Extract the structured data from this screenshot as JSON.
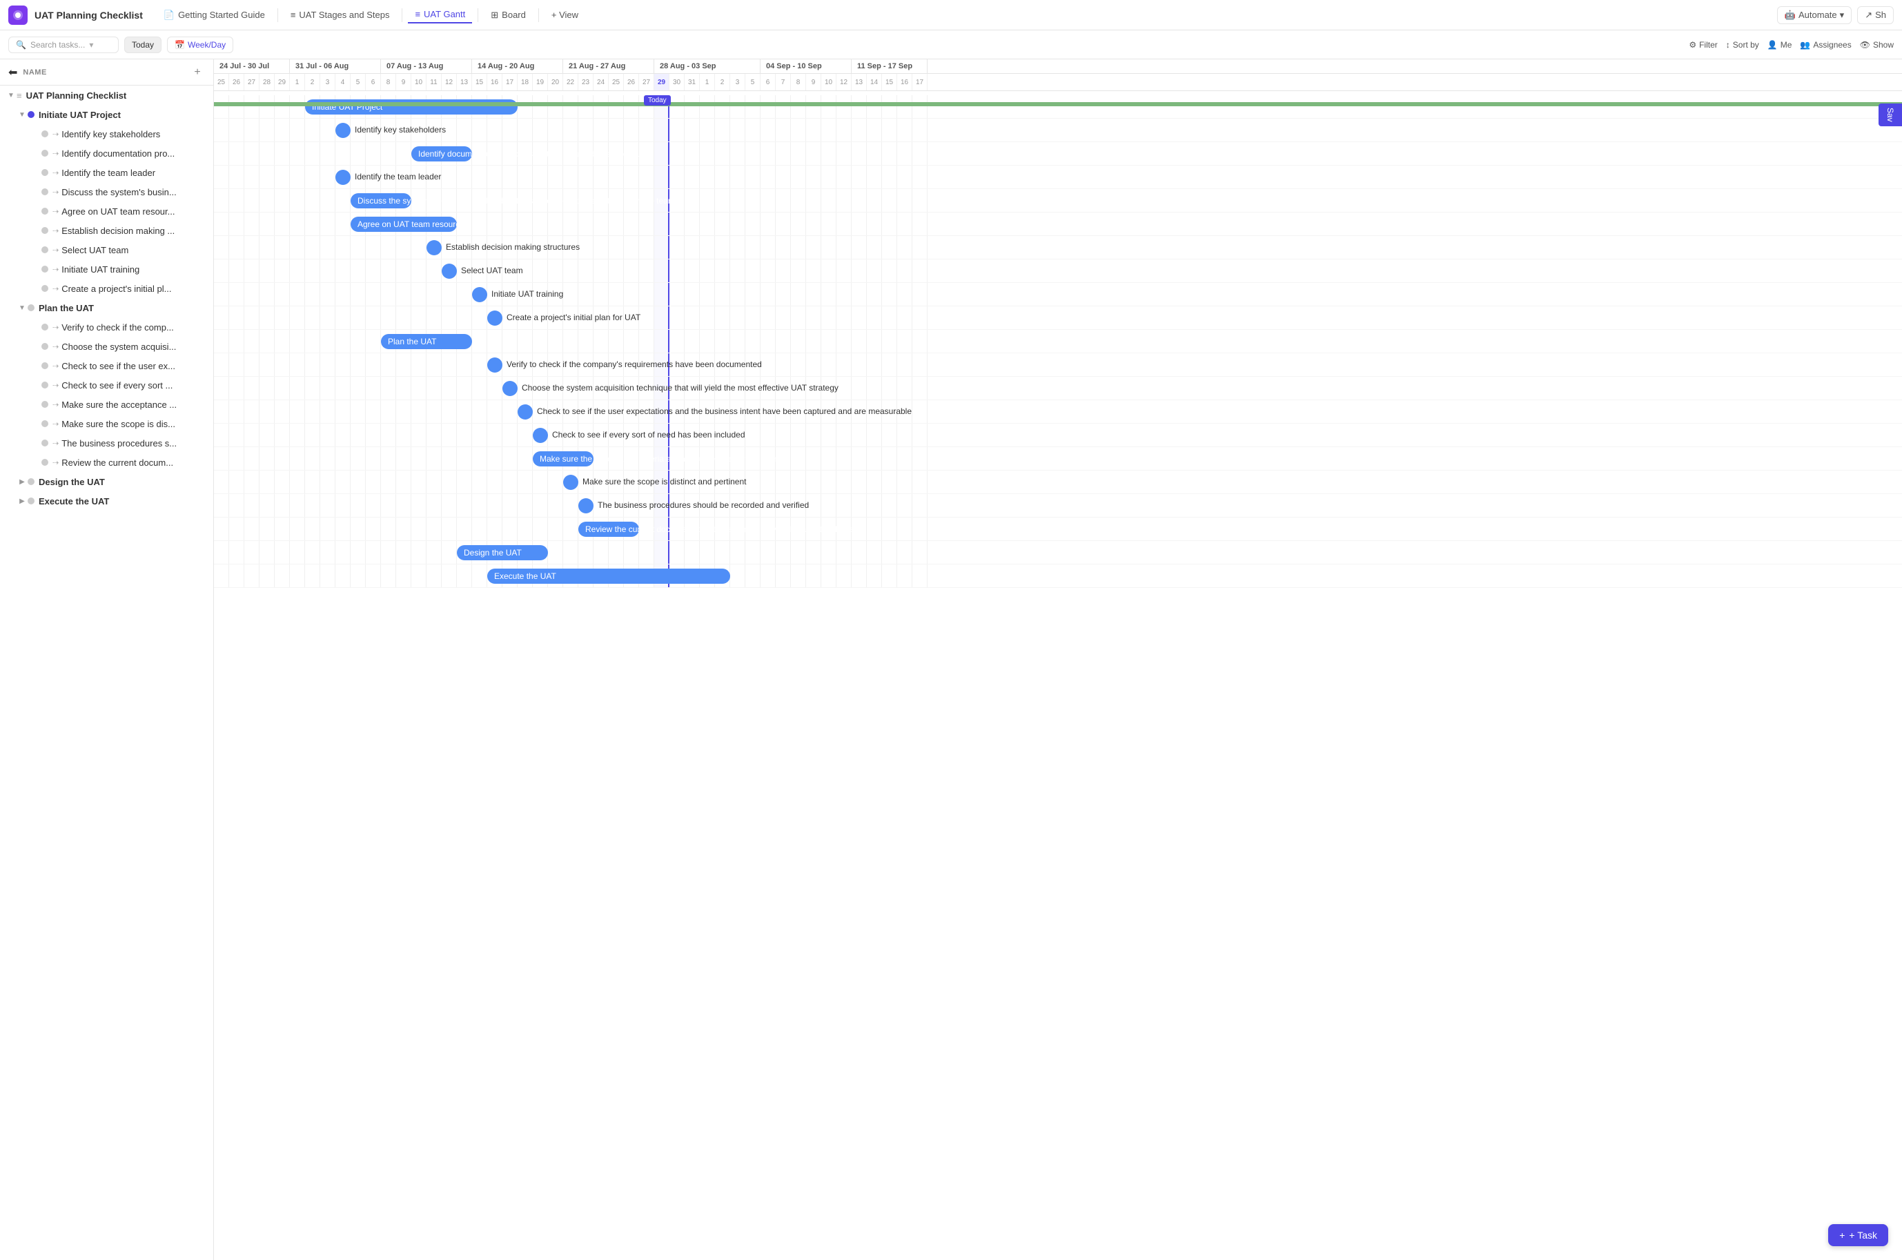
{
  "app": {
    "icon": "◉",
    "title": "UAT Planning Checklist"
  },
  "nav": {
    "tabs": [
      {
        "id": "getting-started",
        "label": "Getting Started Guide",
        "icon": "📄",
        "active": false
      },
      {
        "id": "stages-steps",
        "label": "UAT Stages and Steps",
        "icon": "≡",
        "active": false
      },
      {
        "id": "gantt",
        "label": "UAT Gantt",
        "icon": "≡",
        "active": true
      },
      {
        "id": "board",
        "label": "Board",
        "icon": "⊞",
        "active": false
      }
    ],
    "add_view": "+ View",
    "automate": "Automate",
    "share": "Sh"
  },
  "toolbar": {
    "search_placeholder": "Search tasks...",
    "today": "Today",
    "week_day": "Week/Day",
    "filter": "Filter",
    "sort_by": "Sort by",
    "me": "Me",
    "assignees": "Assignees",
    "show": "Show"
  },
  "left_panel": {
    "header": "NAME",
    "tree": [
      {
        "id": "root",
        "label": "UAT Planning Checklist",
        "indent": 0,
        "type": "section",
        "expanded": true,
        "chevron": "▼"
      },
      {
        "id": "initiate",
        "label": "Initiate UAT Project",
        "indent": 1,
        "type": "group",
        "expanded": true,
        "chevron": "▼",
        "color": "blue"
      },
      {
        "id": "t1",
        "label": "Identify key stakeholders",
        "indent": 2,
        "type": "task"
      },
      {
        "id": "t2",
        "label": "Identify documentation pro...",
        "indent": 2,
        "type": "task"
      },
      {
        "id": "t3",
        "label": "Identify the team leader",
        "indent": 2,
        "type": "task"
      },
      {
        "id": "t4",
        "label": "Discuss the system's busin...",
        "indent": 2,
        "type": "task"
      },
      {
        "id": "t5",
        "label": "Agree on UAT team resour...",
        "indent": 2,
        "type": "task"
      },
      {
        "id": "t6",
        "label": "Establish decision making ...",
        "indent": 2,
        "type": "task"
      },
      {
        "id": "t7",
        "label": "Select UAT team",
        "indent": 2,
        "type": "task"
      },
      {
        "id": "t8",
        "label": "Initiate UAT training",
        "indent": 2,
        "type": "task"
      },
      {
        "id": "t9",
        "label": "Create a project's initial pl...",
        "indent": 2,
        "type": "task"
      },
      {
        "id": "plan",
        "label": "Plan the UAT",
        "indent": 1,
        "type": "group",
        "expanded": true,
        "chevron": "▼",
        "color": "gray"
      },
      {
        "id": "p1",
        "label": "Verify to check if the comp...",
        "indent": 2,
        "type": "task"
      },
      {
        "id": "p2",
        "label": "Choose the system acquisi...",
        "indent": 2,
        "type": "task"
      },
      {
        "id": "p3",
        "label": "Check to see if the user ex...",
        "indent": 2,
        "type": "task"
      },
      {
        "id": "p4",
        "label": "Check to see if every sort ...",
        "indent": 2,
        "type": "task"
      },
      {
        "id": "p5",
        "label": "Make sure the acceptance ...",
        "indent": 2,
        "type": "task"
      },
      {
        "id": "p6",
        "label": "Make sure the scope is dis...",
        "indent": 2,
        "type": "task"
      },
      {
        "id": "p7",
        "label": "The business procedures s...",
        "indent": 2,
        "type": "task"
      },
      {
        "id": "p8",
        "label": "Review the current docum...",
        "indent": 2,
        "type": "task"
      },
      {
        "id": "design",
        "label": "Design the UAT",
        "indent": 1,
        "type": "group",
        "expanded": false,
        "chevron": "▶",
        "color": "gray"
      },
      {
        "id": "execute",
        "label": "Execute the UAT",
        "indent": 1,
        "type": "group",
        "expanded": false,
        "chevron": "▶",
        "color": "gray"
      }
    ]
  },
  "gantt": {
    "months": [
      {
        "label": "24 Jul - 30 Jul",
        "days": [
          "25",
          "26",
          "27",
          "28",
          "29"
        ]
      },
      {
        "label": "31 Jul - 06 Aug",
        "days": [
          "1",
          "2",
          "3",
          "4",
          "5",
          "6"
        ]
      },
      {
        "label": "07 Aug - 13 Aug",
        "days": [
          "8",
          "9",
          "10",
          "11",
          "12",
          "13"
        ]
      },
      {
        "label": "14 Aug - 20 Aug",
        "days": [
          "15",
          "16",
          "17",
          "18",
          "19",
          "20"
        ]
      },
      {
        "label": "21 Aug - 27 Aug",
        "days": [
          "22",
          "23",
          "24",
          "25",
          "26",
          "27"
        ]
      },
      {
        "label": "28 Aug - 03 Sep",
        "days": [
          "29",
          "30",
          "31",
          "1",
          "2",
          "3"
        ]
      },
      {
        "label": "04 Sep - 10 Sep",
        "days": [
          "5",
          "6",
          "7",
          "8",
          "9",
          "10"
        ]
      },
      {
        "label": "11 Sep - 17 Sep",
        "days": [
          "12",
          "13",
          "14",
          "15",
          "16",
          "17"
        ]
      }
    ],
    "today_col_index": 27,
    "today_label": "Today",
    "bars": [
      {
        "label": "Initiate UAT Project",
        "type": "wide",
        "left_col": 6,
        "width_cols": 14,
        "color": "blue"
      },
      {
        "label": "Identify key stakeholders",
        "type": "dot",
        "left_col": 8,
        "color": "blue"
      },
      {
        "label": "Identify documentation process that will be used to support UAT",
        "type": "wide-short",
        "left_col": 13,
        "width_cols": 4,
        "color": "blue"
      },
      {
        "label": "Identify the team leader",
        "type": "dot",
        "left_col": 8,
        "color": "blue"
      },
      {
        "label": "Discuss the system's business goals, objectives, and acceptance criteria with the team",
        "type": "wide-short",
        "left_col": 9,
        "width_cols": 4,
        "color": "blue"
      },
      {
        "label": "Agree on UAT team resources",
        "type": "wide",
        "left_col": 9,
        "width_cols": 7,
        "color": "blue"
      },
      {
        "label": "Establish decision making structures",
        "type": "dot",
        "left_col": 14,
        "color": "blue"
      },
      {
        "label": "Select UAT team",
        "type": "dot",
        "left_col": 15,
        "color": "blue"
      },
      {
        "label": "Initiate UAT training",
        "type": "dot",
        "left_col": 17,
        "color": "blue"
      },
      {
        "label": "Create a project's initial plan for UAT",
        "type": "dot",
        "left_col": 18,
        "color": "blue"
      },
      {
        "label": "Plan the UAT",
        "type": "wide",
        "left_col": 11,
        "width_cols": 6,
        "color": "blue"
      },
      {
        "label": "Verify to check if the company's requirements have been documented",
        "type": "dot",
        "left_col": 18,
        "color": "blue"
      },
      {
        "label": "Choose the system acquisition technique that will yield the most effective UAT strategy",
        "type": "dot",
        "left_col": 19,
        "color": "blue"
      },
      {
        "label": "Check to see if the user expectations and the business intent have been captured and are measurable",
        "type": "dot",
        "left_col": 20,
        "color": "blue"
      },
      {
        "label": "Check to see if every sort of need has been included",
        "type": "dot",
        "left_col": 21,
        "color": "blue"
      },
      {
        "label": "Make sure the acceptance criteria are adequate after writing them",
        "type": "wide-short",
        "left_col": 21,
        "width_cols": 4,
        "color": "blue"
      },
      {
        "label": "Make sure the scope is distinct and pertinent",
        "type": "dot",
        "left_col": 23,
        "color": "blue"
      },
      {
        "label": "The business procedures should be recorded and verified",
        "type": "dot",
        "left_col": 24,
        "color": "blue"
      },
      {
        "label": "Review the current documentation to determine its viability as a test base",
        "type": "wide-short",
        "left_col": 24,
        "width_cols": 4,
        "color": "blue"
      },
      {
        "label": "Design the UAT",
        "type": "wide",
        "left_col": 16,
        "width_cols": 6,
        "color": "blue"
      },
      {
        "label": "Execute the UAT",
        "type": "wide",
        "left_col": 18,
        "width_cols": 16,
        "color": "blue"
      }
    ],
    "save_label": "Sav",
    "task_btn": "+ Task"
  },
  "colors": {
    "blue": "#4f8ef7",
    "light_blue": "#6ab0f5",
    "today_line": "#4f46e5",
    "green_progress": "#7cb87c",
    "today_badge": "#4f46e5"
  }
}
